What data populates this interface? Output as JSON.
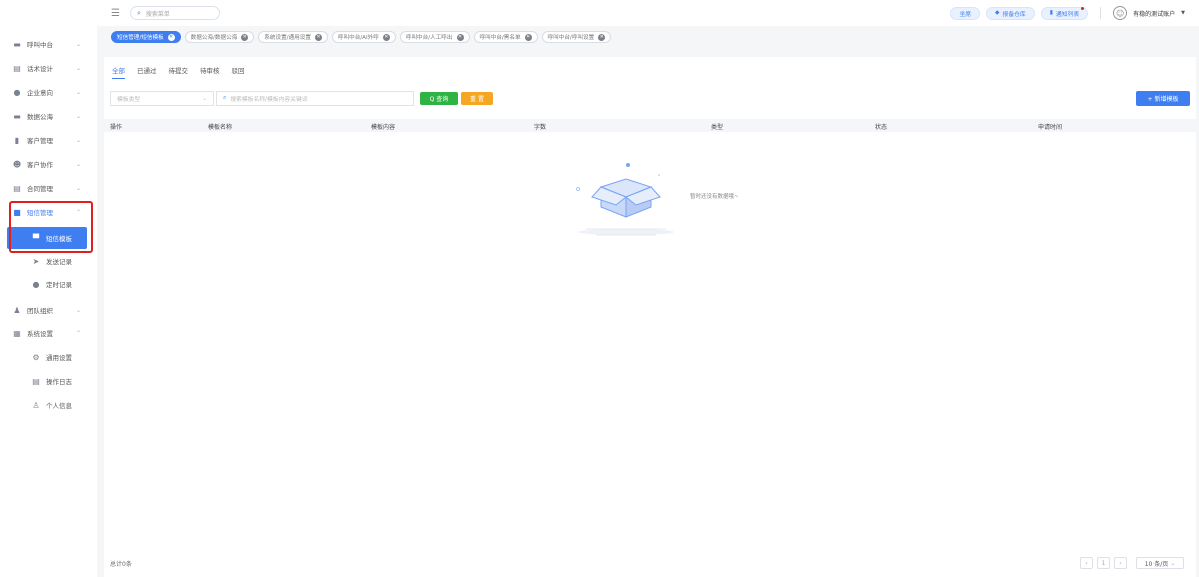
{
  "topbar": {
    "search_placeholder": "搜索菜单",
    "pill_1": "坐席",
    "pill_2": "报备仓库",
    "pill_3": "通知列表",
    "account": "有稳的测试账户"
  },
  "tags": [
    {
      "label": "短信管理/短信模板",
      "active": true
    },
    {
      "label": "数据公海/数据公海"
    },
    {
      "label": "系统设置/通用设置"
    },
    {
      "label": "呼叫中台/AI外呼"
    },
    {
      "label": "呼叫中台/人工呼出"
    },
    {
      "label": "呼叫中台/黑名单"
    },
    {
      "label": "呼叫中台/呼叫设置"
    }
  ],
  "sidebar": {
    "items": [
      {
        "label": "呼叫中台",
        "icon": "monitor-icon"
      },
      {
        "label": "话术设计",
        "icon": "document-icon"
      },
      {
        "label": "企业意向",
        "icon": "pin-icon"
      },
      {
        "label": "数据公海",
        "icon": "database-icon"
      },
      {
        "label": "客户管理",
        "icon": "customer-icon"
      },
      {
        "label": "客户协作",
        "icon": "smile-icon"
      },
      {
        "label": "合同管理",
        "icon": "contract-icon"
      },
      {
        "label": "短信管理",
        "icon": "message-icon"
      },
      {
        "label": "短信模板",
        "icon": "chat-icon"
      },
      {
        "label": "发送记录",
        "icon": "send-icon"
      },
      {
        "label": "定时记录",
        "icon": "clock-icon"
      },
      {
        "label": "团队组织",
        "icon": "team-icon"
      },
      {
        "label": "系统设置",
        "icon": "grid-icon"
      },
      {
        "label": "通用设置",
        "icon": "gear-icon"
      },
      {
        "label": "操作日志",
        "icon": "log-icon"
      },
      {
        "label": "个人信息",
        "icon": "user-icon"
      }
    ]
  },
  "main": {
    "tabs": [
      "全部",
      "已通过",
      "待提交",
      "待审核",
      "驳回"
    ],
    "filter_type_placeholder": "模板类型",
    "search_placeholder": "搜索模板名称/模板内容关键词",
    "query_label": "Q 查询",
    "reset_label": "重 置",
    "add_label": "+ 新增模板",
    "columns": [
      "操作",
      "模板名称",
      "模板内容",
      "字数",
      "类型",
      "状态",
      "申请时间"
    ],
    "empty_text": "暂时还没有数据哦~",
    "total": "总计0条",
    "page_size": "10 条/页",
    "page_number": "1"
  }
}
